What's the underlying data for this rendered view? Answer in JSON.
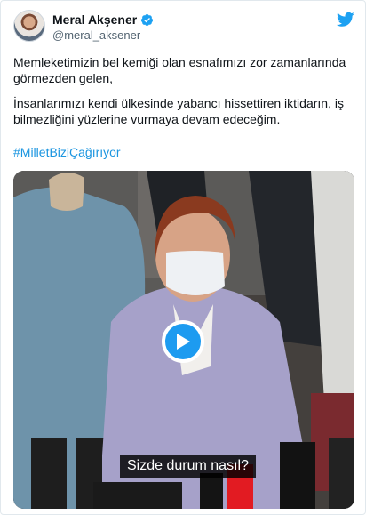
{
  "author": {
    "display_name": "Meral Akşener",
    "handle": "@meral_aksener",
    "verified": true,
    "avatar_icon": "avatar-photo"
  },
  "brand": {
    "logo_icon": "twitter-bird-icon",
    "accent_color": "#1da1f2",
    "hashtag_color": "#1b95e0"
  },
  "tweet": {
    "paragraph1": "Memleketimizin bel kemiği olan esnafımızı zor zamanlarında görmezden gelen,",
    "paragraph2": "İnsanlarımızı kendi ülkesinde yabancı hissettiren iktidarın, iş bilmezliğini yüzlerine vurmaya devam edeceğim.",
    "hashtag": "#MilletBiziÇağırıyor"
  },
  "video": {
    "caption": "Sizde durum nasıl?",
    "play_icon": "play-icon"
  }
}
